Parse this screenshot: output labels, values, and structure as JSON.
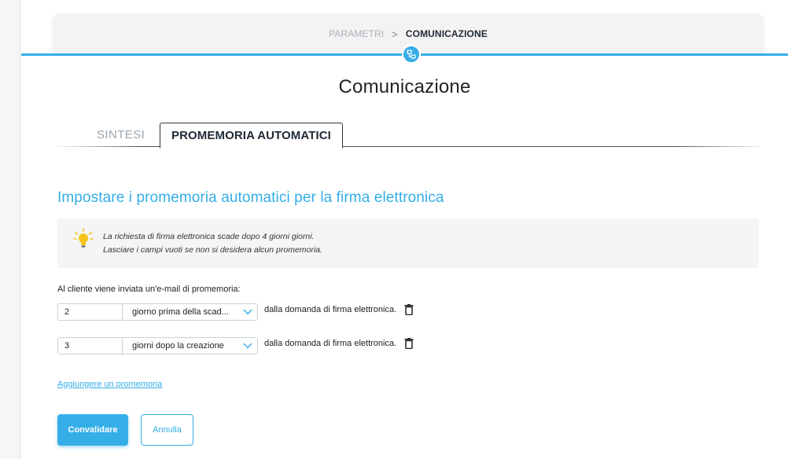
{
  "breadcrumb": {
    "parent": "PARAMETRI",
    "separator": ">",
    "current": "COMUNICAZIONE"
  },
  "page_title": "Comunicazione",
  "tabs": [
    {
      "label": "SINTESI",
      "active": false
    },
    {
      "label": "PROMEMORIA AUTOMATICI",
      "active": true
    }
  ],
  "section_title": "Impostare i promemoria automatici per la firma elettronica",
  "info": {
    "icon": "lightbulb-icon",
    "line1": "La richiesta di firma elettronica scade dopo 4 giorni giorni.",
    "line2": "Lasciare i campi vuoti se non si desidera alcun promemoria."
  },
  "reminder_label": "Al cliente viene inviata un'e-mail di promemoria:",
  "reminders": [
    {
      "days": "2",
      "timing": "giorno prima della scad...",
      "suffix": "dalla domanda di firma elettronica."
    },
    {
      "days": "3",
      "timing": "giorni dopo la creazione",
      "suffix": "dalla domanda di firma elettronica."
    }
  ],
  "add_link": "Aggiungere un promemoria",
  "buttons": {
    "confirm": "Convalidare",
    "cancel": "Annulla"
  },
  "colors": {
    "accent": "#35aee8",
    "bulb": "#f5c518"
  }
}
